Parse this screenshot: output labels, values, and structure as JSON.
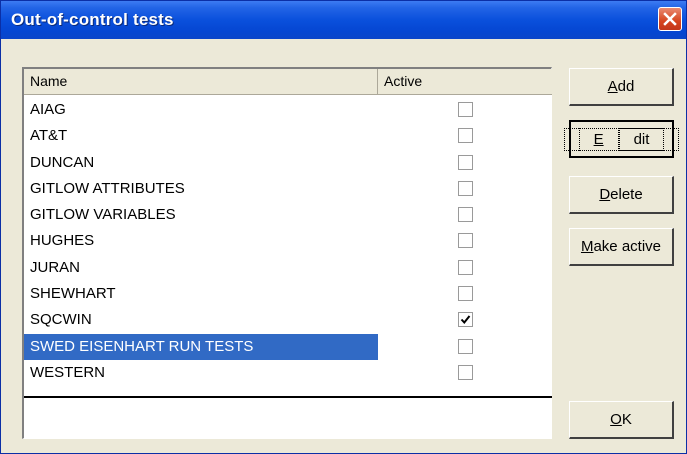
{
  "window": {
    "title": "Out-of-control tests"
  },
  "list": {
    "columns": {
      "name": "Name",
      "active": "Active"
    },
    "rows": [
      {
        "name": "AIAG",
        "active": false,
        "selected": false
      },
      {
        "name": "AT&T",
        "active": false,
        "selected": false
      },
      {
        "name": "DUNCAN",
        "active": false,
        "selected": false
      },
      {
        "name": "GITLOW ATTRIBUTES",
        "active": false,
        "selected": false
      },
      {
        "name": "GITLOW VARIABLES",
        "active": false,
        "selected": false
      },
      {
        "name": "HUGHES",
        "active": false,
        "selected": false
      },
      {
        "name": "JURAN",
        "active": false,
        "selected": false
      },
      {
        "name": "SHEWHART",
        "active": false,
        "selected": false
      },
      {
        "name": "SQCWIN",
        "active": true,
        "selected": false
      },
      {
        "name": "SWED EISENHART RUN TESTS",
        "active": false,
        "selected": true
      },
      {
        "name": "WESTERN",
        "active": false,
        "selected": false
      }
    ]
  },
  "buttons": {
    "add": {
      "mnemonic": "A",
      "rest": "dd"
    },
    "edit": {
      "mnemonic": "E",
      "rest": "dit"
    },
    "delete": {
      "mnemonic": "D",
      "rest": "elete"
    },
    "make_active": {
      "mnemonic": "M",
      "rest": "ake active"
    },
    "ok": {
      "mnemonic": "O",
      "rest": "K"
    }
  },
  "colors": {
    "selection": "#316ac5",
    "titlebar": "#0a50dc",
    "close": "#d6451e"
  }
}
